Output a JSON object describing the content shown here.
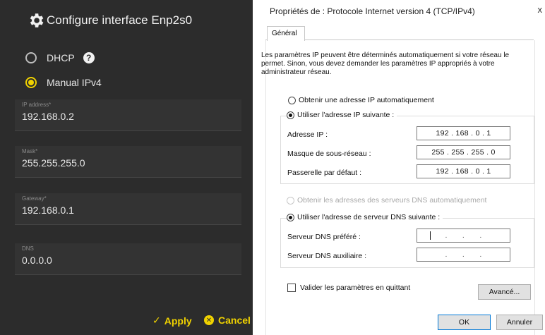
{
  "left_panel": {
    "title": "Configure interface Enp2s0",
    "dhcp_label": "DHCP",
    "help_glyph": "?",
    "manual_label": "Manual IPv4",
    "fields": [
      {
        "label": "IP address*",
        "value": "192.168.0.2"
      },
      {
        "label": "Mask*",
        "value": "255.255.255.0"
      },
      {
        "label": "Gateway*",
        "value": "192.168.0.1"
      },
      {
        "label": "DNS",
        "value": "0.0.0.0"
      }
    ],
    "apply_label": "Apply",
    "cancel_label": "Cancel",
    "accent_color": "#f0d200"
  },
  "dialog": {
    "title": "Propriétés de : Protocole Internet version 4 (TCP/IPv4)",
    "close_glyph": "x",
    "tab_general": "Général",
    "intro_text": "Les paramètres IP peuvent être déterminés automatiquement si votre réseau le permet. Sinon, vous devez demander les paramètres IP appropriés à votre administrateur réseau.",
    "radio_auto_ip": "Obtenir une adresse IP automatiquement",
    "radio_manual_ip": "Utiliser l'adresse IP suivante :",
    "ip_label": "Adresse IP :",
    "ip_value": "192 . 168 . 0 . 1",
    "mask_label": "Masque de sous-réseau :",
    "mask_value": "255 . 255 . 255 . 0",
    "gateway_label": "Passerelle par défaut :",
    "gateway_value": "192 . 168 . 0 . 1",
    "radio_auto_dns": "Obtenir les adresses des serveurs DNS automatiquement",
    "radio_manual_dns": "Utiliser l'adresse de serveur DNS suivante :",
    "dns_pref_label": "Serveur DNS préféré :",
    "dns_pref_value": ". . .",
    "dns_alt_label": "Serveur DNS auxiliaire :",
    "dns_alt_value": ". . .",
    "validate_label": "Valider les paramètres en quittant",
    "advanced_label": "Avancé...",
    "ok_label": "OK",
    "cancel_label": "Annuler"
  }
}
